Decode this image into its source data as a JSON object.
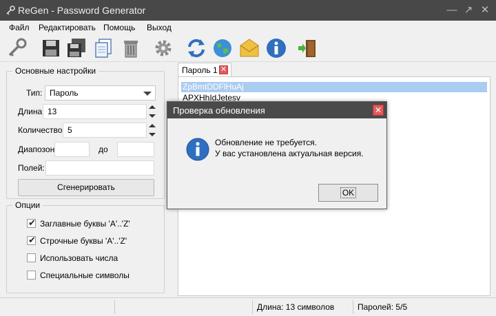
{
  "window": {
    "title": "ReGen - Password Generator"
  },
  "menu": [
    "Файл",
    "Редактировать",
    "Помощь",
    "Выход"
  ],
  "toolbar": {
    "icons": [
      "key-icon",
      "save-icon",
      "save-all-icon",
      "copy-icon",
      "delete-icon",
      "settings-icon",
      "refresh-icon",
      "globe-icon",
      "mail-icon",
      "info-icon",
      "exit-icon"
    ]
  },
  "settings": {
    "title": "Основные настройки",
    "type_label": "Тип:",
    "type_value": "Пароль",
    "length_label": "Длина:",
    "length_value": "13",
    "count_label": "Количество:",
    "count_value": "5",
    "range_label": "Диапозон:",
    "range_to_label": "до",
    "fields_label": "Полей:",
    "generate_label": "Сгенерировать"
  },
  "options": {
    "title": "Опции",
    "items": [
      {
        "label": "Заглавные буквы 'A'..'Z'",
        "checked": true
      },
      {
        "label": "Строчные буквы 'A'..'Z'",
        "checked": true
      },
      {
        "label": "Использовать числа",
        "checked": false
      },
      {
        "label": "Специальные символы",
        "checked": false
      }
    ]
  },
  "tab": {
    "label": "Пароль 1"
  },
  "passwords": [
    "ZpBmtDDFlHuAj",
    "APXHhIdJetesv"
  ],
  "status": {
    "length": "Длина: 13 символов",
    "count": "Паролей: 5/5"
  },
  "dialog": {
    "title": "Проверка обновления",
    "line1": "Обновление не требуется.",
    "line2": "У вас установлена актуальная версия.",
    "ok": "OK"
  },
  "colors": {
    "titlebar": "#484848",
    "selection": "#aaccf0",
    "accent_blue": "#2f6fc0"
  }
}
